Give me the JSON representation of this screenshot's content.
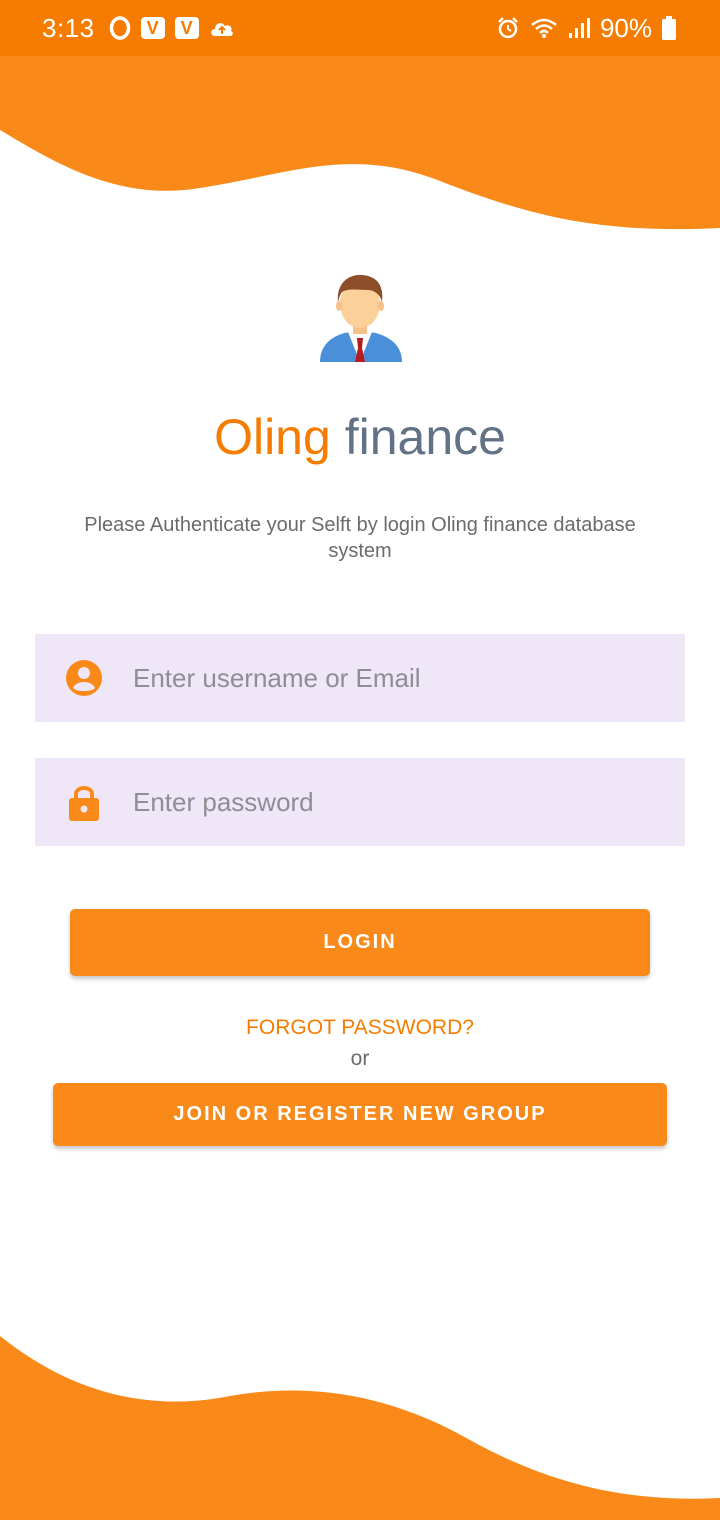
{
  "status_bar": {
    "time": "3:13",
    "battery_percent": "90%",
    "icons_left": [
      "opera-icon",
      "v-badge-icon",
      "v-badge-icon",
      "cloud-upload-icon"
    ],
    "icons_right": [
      "alarm-icon",
      "wifi-icon",
      "signal-icon",
      "battery-icon"
    ],
    "v_badge_letter": "V"
  },
  "theme": {
    "accent": "#f57c00",
    "button": "#f98a1a",
    "title_secondary": "#617285",
    "input_background": "#efe6f8"
  },
  "header": {
    "avatar_icon": "businessman-avatar-icon",
    "title_part_1": "Oling",
    "title_part_2": "finance",
    "subtitle": "Please Authenticate your Selft by login Oling finance database system"
  },
  "form": {
    "username": {
      "icon": "account-circle-icon",
      "placeholder": "Enter username or Email",
      "value": ""
    },
    "password": {
      "icon": "lock-icon",
      "placeholder": "Enter password",
      "value": ""
    },
    "login_label": "LOGIN",
    "forgot_label": "FORGOT PASSWORD?",
    "or_label": "or",
    "register_label": "JOIN OR REGISTER NEW GROUP"
  }
}
